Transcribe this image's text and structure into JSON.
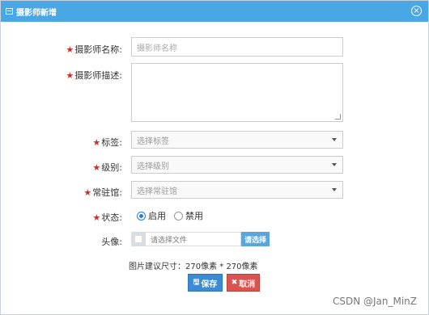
{
  "dialog": {
    "title": "摄影师新增",
    "close_label": "×"
  },
  "form": {
    "required_mark": "★",
    "name": {
      "label": "摄影师名称:",
      "placeholder": "摄影师名称"
    },
    "description": {
      "label": "摄影师描述:"
    },
    "tags": {
      "label": "标签:",
      "value": "选择标签"
    },
    "level": {
      "label": "级别:",
      "value": "选择级别"
    },
    "venue": {
      "label": "常驻馆:",
      "value": "选择常驻馆"
    },
    "status": {
      "label": "状态:",
      "options": [
        "启用",
        "禁用"
      ],
      "selected": "启用"
    },
    "avatar": {
      "label": "头像:",
      "placeholder": "请选择文件",
      "button": "请选择"
    },
    "hint": "图片建议尺寸：270像素 * 270像素"
  },
  "actions": {
    "save_icon": "floppy-disk-icon",
    "save": "保存",
    "cancel_icon": "x-icon",
    "cancel": "取消"
  },
  "watermark": "CSDN @Jan_MinZ"
}
